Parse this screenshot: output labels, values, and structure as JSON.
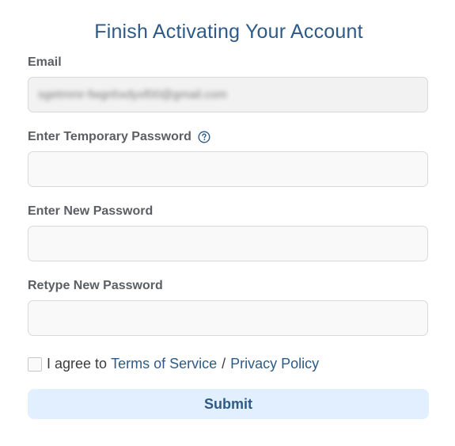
{
  "form": {
    "title": "Finish Activating Your Account",
    "email": {
      "label": "Email",
      "value": "sgetmmr-fwgnhxdyxf00@gmail.com"
    },
    "temp_password": {
      "label": "Enter Temporary Password",
      "help_icon": "question-circle-icon"
    },
    "new_password": {
      "label": "Enter New Password"
    },
    "retype_password": {
      "label": "Retype New Password"
    },
    "agreement": {
      "prefix": "I agree to",
      "terms": "Terms of Service",
      "separator": "/",
      "privacy": "Privacy Policy"
    },
    "submit_label": "Submit"
  },
  "colors": {
    "accent": "#2d5a86",
    "label": "#5b5f63",
    "button_bg": "#e1efff",
    "field_border": "#d9d9d9"
  }
}
